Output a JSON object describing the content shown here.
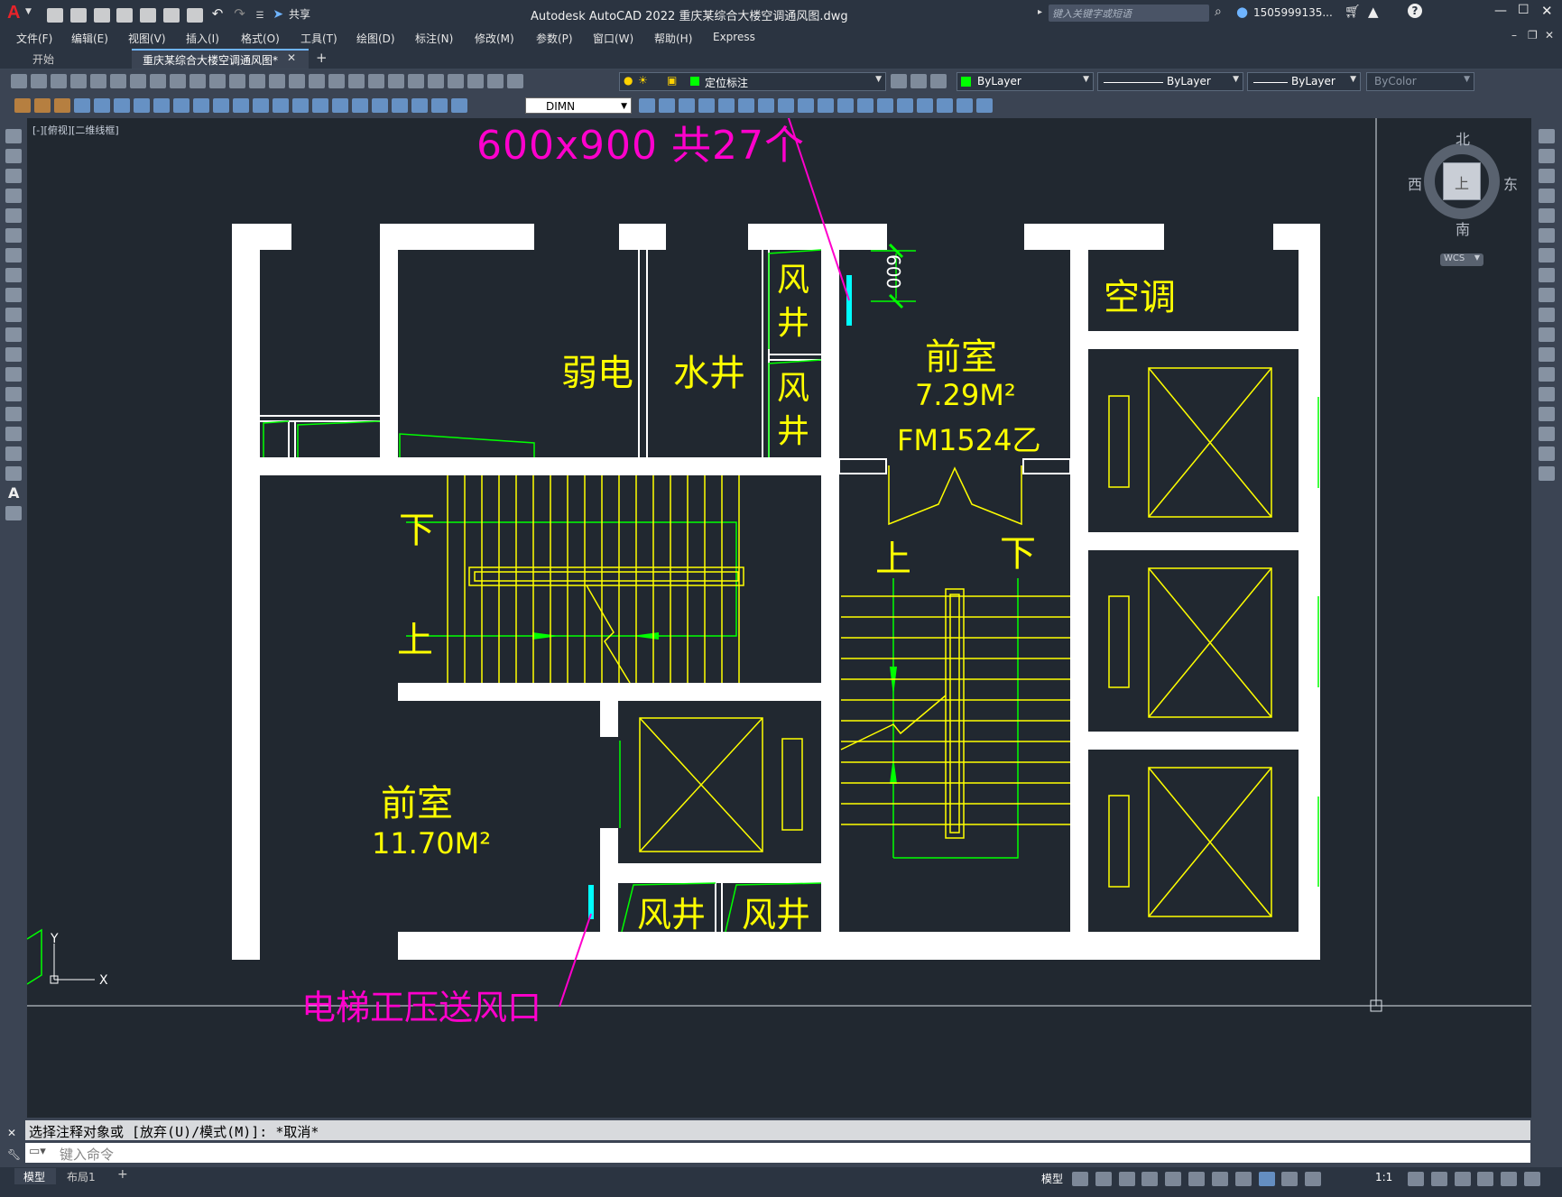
{
  "window": {
    "title": "Autodesk AutoCAD 2022    重庆某综合大楼空调通风图.dwg",
    "search_placeholder": "键入关键字或短语",
    "user": "1505999135...",
    "share_label": "共享",
    "app_logo": "A"
  },
  "menu": [
    "文件(F)",
    "编辑(E)",
    "视图(V)",
    "插入(I)",
    "格式(O)",
    "工具(T)",
    "绘图(D)",
    "标注(N)",
    "修改(M)",
    "参数(P)",
    "窗口(W)",
    "帮助(H)",
    "Express"
  ],
  "tabs": {
    "start": "开始",
    "drawing": "重庆某综合大楼空调通风图*"
  },
  "toolbar": {
    "layer": "定位标注",
    "color": "ByLayer",
    "linetype": "ByLayer",
    "lineweight": "ByLayer",
    "plotstyle": "ByColor",
    "dimstyle": "DIMN"
  },
  "viewport": {
    "label": "[-][俯视][二维线框]"
  },
  "compass": {
    "north": "北",
    "south": "南",
    "east": "东",
    "west": "西",
    "top": "上",
    "wcs": "WCS"
  },
  "ucs": {
    "x": "X",
    "y": "Y"
  },
  "drawing": {
    "note_top": "600x900 共27个",
    "note_bottom": "电梯正压送风口",
    "dim_600": "600",
    "room_weak": "弱电",
    "room_water": "水井",
    "room_shaft": "风井",
    "room_ac": "空调",
    "anteroom1_name": "前室",
    "anteroom1_area": "7.29M²",
    "anteroom1_door": "FM1524乙",
    "anteroom2_name": "前室",
    "anteroom2_area": "11.70M²",
    "stair_up": "上",
    "stair_down": "下",
    "shaft_pair_left": "风井",
    "shaft_pair_right": "风井"
  },
  "command": {
    "history": "选择注释对象或 [放弃(U)/模式(M)]: *取消*",
    "placeholder": "键入命令"
  },
  "status": {
    "model_tab": "模型",
    "layout_tab": "布局1",
    "add_tab": "+",
    "model_mode": "模型",
    "scale": "1:1"
  },
  "colors": {
    "wall": "#ffffff",
    "annotation": "#ffff00",
    "text_magenta": "#ff00cc",
    "green": "#00ff00",
    "cyan": "#00ffff",
    "background": "#212830"
  }
}
